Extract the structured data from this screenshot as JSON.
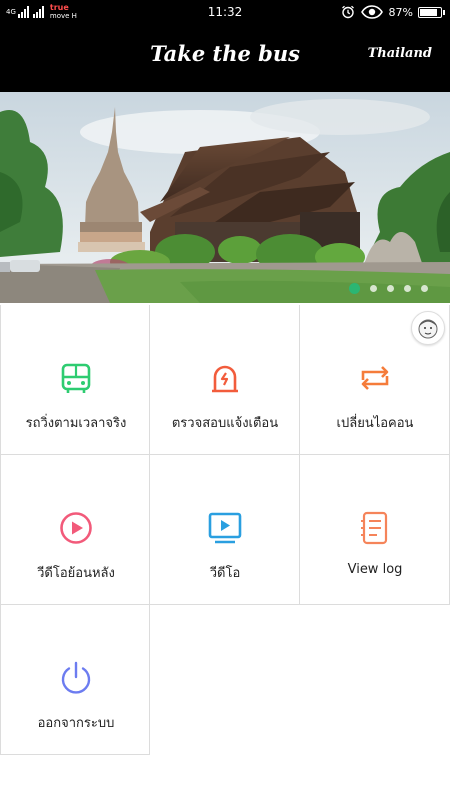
{
  "status_bar": {
    "network_label": "4G",
    "carrier_top": "true",
    "carrier_bottom": "move H",
    "time": "11:32",
    "battery_percent": "87%",
    "battery_level": 0.87
  },
  "header": {
    "title": "Take the bus",
    "country": "Thailand"
  },
  "banner": {
    "slide_count": 5,
    "active_index": 0
  },
  "menu": {
    "items": [
      {
        "label": "รถวิ่งตามเวลาจริง",
        "icon": "bus-icon",
        "color": "#2ecc71"
      },
      {
        "label": "ตรวจสอบแจ้งเตือน",
        "icon": "alarm-icon",
        "color": "#f25c3c"
      },
      {
        "label": "เปลี่ยนไอคอน",
        "icon": "switch-icon",
        "color": "#f57c3a"
      },
      {
        "label": "วีดีโอย้อนหลัง",
        "icon": "play-circle-icon",
        "color": "#f25a7a"
      },
      {
        "label": "วีดีโอ",
        "icon": "video-screen-icon",
        "color": "#2a9fe0"
      },
      {
        "label": "View log",
        "icon": "log-icon",
        "color": "#f5845a"
      },
      {
        "label": "ออกจากระบบ",
        "icon": "power-icon",
        "color": "#6c7cf0"
      }
    ]
  }
}
